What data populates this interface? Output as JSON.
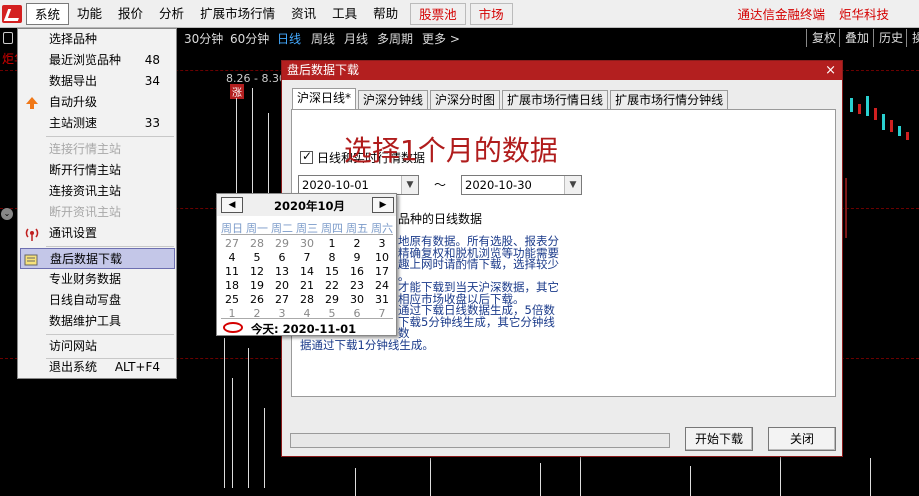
{
  "menubar": {
    "items": [
      "系统",
      "功能",
      "报价",
      "分析",
      "扩展市场行情",
      "资讯",
      "工具",
      "帮助"
    ],
    "boxed": [
      "股票池",
      "市场"
    ],
    "right": [
      "通达信金融终端",
      "炬华科技"
    ]
  },
  "toolbar2": {
    "periods": [
      "30分钟",
      "60分钟",
      "日线",
      "周线",
      "月线",
      "多周期",
      "更多 >"
    ],
    "right_buttons": [
      "复权",
      "叠加",
      "历史",
      "操"
    ]
  },
  "chart": {
    "labels": {
      "top_left": "炬华",
      "date_range": "8.26 - 8.30",
      "badge": "涨"
    }
  },
  "dropdown": {
    "items": [
      {
        "label": "选择品种",
        "num": ""
      },
      {
        "label": "最近浏览品种",
        "num": "48"
      },
      {
        "label": "数据导出",
        "num": "34"
      },
      {
        "label": "自动升级",
        "num": ""
      },
      {
        "label": "主站测速",
        "num": "33"
      },
      {
        "label": "连接行情主站",
        "num": ""
      },
      {
        "label": "断开行情主站",
        "num": ""
      },
      {
        "label": "连接资讯主站",
        "num": ""
      },
      {
        "label": "断开资讯主站",
        "num": ""
      },
      {
        "label": "通讯设置",
        "num": ""
      },
      {
        "label": "盘后数据下载",
        "num": ""
      },
      {
        "label": "专业财务数据",
        "num": ""
      },
      {
        "label": "日线自动写盘",
        "num": ""
      },
      {
        "label": "数据维护工具",
        "num": ""
      },
      {
        "label": "访问网站",
        "num": ""
      },
      {
        "label": "退出系统",
        "num": "ALT+F4"
      }
    ]
  },
  "dialog": {
    "title": "盘后数据下载",
    "close": "×",
    "tabs": [
      "沪深日线*",
      "沪深分钟线",
      "沪深分时图",
      "扩展市场行情日线",
      "扩展市场行情分钟线"
    ],
    "big_title": "选择1个月的数据",
    "checkbox_label": "日线和实时行情数据",
    "start_date": "2020-10-01",
    "end_date": "2020-10-30",
    "tilde": "～",
    "radio_label": "品种的日线数据",
    "desc_lines": [
      "地原有数据。所有选股、报表分",
      "精确复权和脱机浏览等功能需要",
      "趣上网时请酌情下载，选择较少",
      "。",
      "才能下载到当天沪深数据，其它",
      "相应市场收盘以后下载。",
      "通过下载日线数据生成，5倍数",
      "下载5分钟线生成，其它分钟线数",
      "据通过下载1分钟线生成。"
    ],
    "start_button": "开始下载",
    "close_button": "关闭"
  },
  "calendar": {
    "title": "2020年10月",
    "weekdays": [
      "周日",
      "周一",
      "周二",
      "周三",
      "周四",
      "周五",
      "周六"
    ],
    "weeks": [
      [
        "27",
        "28",
        "29",
        "30",
        "1",
        "2",
        "3"
      ],
      [
        "4",
        "5",
        "6",
        "7",
        "8",
        "9",
        "10"
      ],
      [
        "11",
        "12",
        "13",
        "14",
        "15",
        "16",
        "17"
      ],
      [
        "18",
        "19",
        "20",
        "21",
        "22",
        "23",
        "24"
      ],
      [
        "25",
        "26",
        "27",
        "28",
        "29",
        "30",
        "31"
      ],
      [
        "1",
        "2",
        "3",
        "4",
        "5",
        "6",
        "7"
      ]
    ],
    "today": "今天:  2020-11-01"
  },
  "colors": {
    "accent": "#b31f1f",
    "menu_red": "#d40000",
    "highlight": "#c4c7e8"
  }
}
